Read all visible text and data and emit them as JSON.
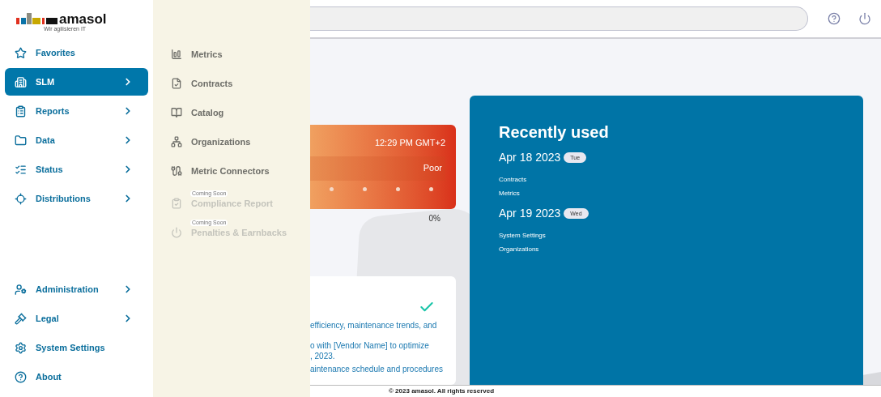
{
  "logo": {
    "name": "amasol",
    "tagline": "Wir agilisieren IT"
  },
  "sidebar": {
    "items": [
      {
        "label": "Favorites",
        "selected": false,
        "has_submenu": false
      },
      {
        "label": "SLM",
        "selected": true,
        "has_submenu": true
      },
      {
        "label": "Reports",
        "selected": false,
        "has_submenu": true
      },
      {
        "label": "Data",
        "selected": false,
        "has_submenu": true
      },
      {
        "label": "Status",
        "selected": false,
        "has_submenu": true
      },
      {
        "label": "Distributions",
        "selected": false,
        "has_submenu": true
      }
    ],
    "bottom_items": [
      {
        "label": "Administration",
        "selected": false,
        "has_submenu": true
      },
      {
        "label": "Legal",
        "selected": false,
        "has_submenu": true
      },
      {
        "label": "System Settings",
        "selected": false,
        "has_submenu": false
      },
      {
        "label": "About",
        "selected": false,
        "has_submenu": false
      }
    ]
  },
  "submenu": {
    "items": [
      {
        "label": "Metrics",
        "disabled": false
      },
      {
        "label": "Contracts",
        "disabled": false
      },
      {
        "label": "Catalog",
        "disabled": false
      },
      {
        "label": "Organizations",
        "disabled": false
      },
      {
        "label": "Metric Connectors",
        "disabled": false
      },
      {
        "label": "Compliance Report",
        "disabled": true,
        "badge": "Coming Soon"
      },
      {
        "label": "Penalties & Earnbacks",
        "disabled": true,
        "badge": "Coming Soon"
      }
    ]
  },
  "status_card": {
    "time": "12:29 PM GMT+2",
    "rating": "Poor",
    "percent": "0%"
  },
  "task_card": {
    "lines": [
      "efficiency, maintenance trends, and",
      "o with [Vendor Name] to optimize",
      ", 2023.",
      "aintenance schedule and procedures"
    ]
  },
  "recently_used": {
    "title": "Recently used",
    "groups": [
      {
        "date": "Apr 18 2023",
        "day": "Tue",
        "items": [
          "Contracts",
          "Metrics"
        ]
      },
      {
        "date": "Apr 19 2023",
        "day": "Wed",
        "items": [
          "System Settings",
          "Organizations"
        ]
      }
    ]
  },
  "footer": "© 2023 amasol. All rights reserved"
}
